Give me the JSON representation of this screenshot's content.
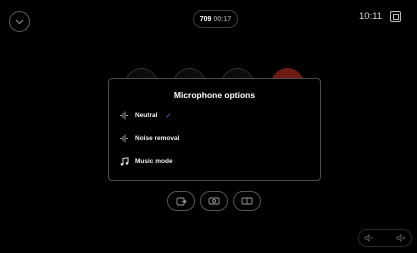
{
  "top_bar": {
    "call_id": "709",
    "call_duration": "00:17",
    "clock": "10:11"
  },
  "dialog": {
    "title": "Microphone options",
    "options": [
      {
        "label": "Neutral",
        "icon": "waveform-icon",
        "selected": true
      },
      {
        "label": "Noise removal",
        "icon": "waveform-icon",
        "selected": false
      },
      {
        "label": "Music mode",
        "icon": "music-note-icon",
        "selected": false
      }
    ],
    "check_icon": "checkmark-icon"
  },
  "bottom_controls": [
    {
      "icon": "share-screen-icon"
    },
    {
      "icon": "camera-icon"
    },
    {
      "icon": "pip-icon"
    }
  ],
  "volume": {
    "down_icon": "volume-down-icon",
    "up_icon": "volume-up-icon"
  },
  "colors": {
    "accent": "#3b7fd6",
    "end_call": "#6e1a16",
    "background": "#000000",
    "border": "#4e4e4e"
  }
}
